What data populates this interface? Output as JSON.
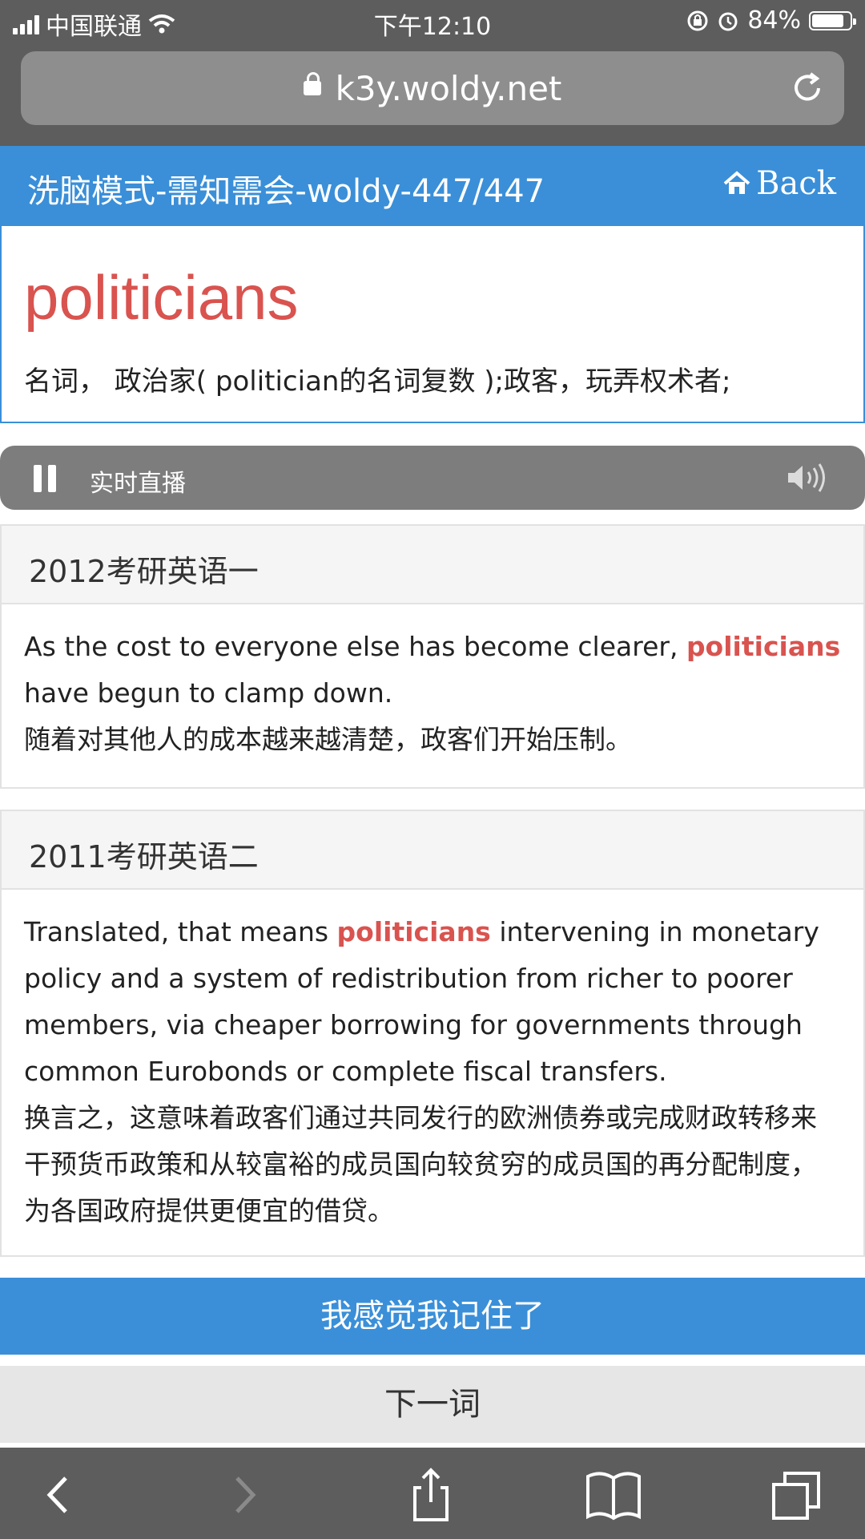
{
  "status_bar": {
    "carrier": "中国联通",
    "time": "下午12:10",
    "battery_percent": "84%",
    "battery_level": 0.84
  },
  "browser": {
    "url": "k3y.woldy.net"
  },
  "header": {
    "title": "洗脑模式-需知需会-woldy-447/447",
    "back_label": "Back"
  },
  "word": {
    "text": "politicians",
    "definition": "名词， 政治家( politician的名词复数 );政客，玩弄权术者;"
  },
  "live": {
    "label": "实时直播"
  },
  "examples": [
    {
      "source": "2012考研英语一",
      "en_before": "As the cost to everyone else has become clearer, ",
      "en_highlight": "politicians",
      "en_after": " have begun to clamp down.",
      "zh": "随着对其他人的成本越来越清楚，政客们开始压制。"
    },
    {
      "source": "2011考研英语二",
      "en_before": "Translated, that means ",
      "en_highlight": "politicians",
      "en_after": " intervening in monetary policy and a system of redistribution from richer to poorer members, via cheaper borrowing for governments through common Eurobonds or complete fiscal transfers.",
      "zh": "换言之，这意味着政客们通过共同发行的欧洲债券或完成财政转移来干预货币政策和从较富裕的成员国向较贫穷的成员国的再分配制度，为各国政府提供更便宜的借贷。"
    }
  ],
  "actions": {
    "remember_label": "我感觉我记住了",
    "next_label": "下一词"
  },
  "colors": {
    "accent": "#3a8fd8",
    "highlight": "#d9534f"
  }
}
